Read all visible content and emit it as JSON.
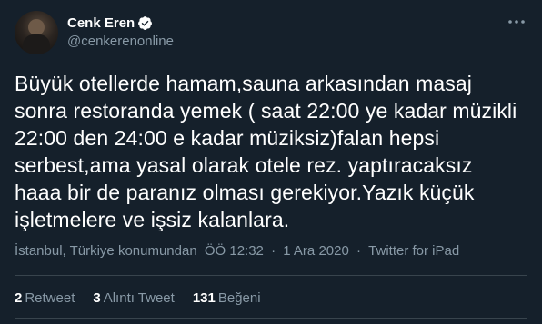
{
  "author": {
    "display_name": "Cenk Eren",
    "handle": "@cenkerenonline",
    "verified": true,
    "avatar_icon": "profile-photo"
  },
  "more_icon": "more-options-icon",
  "tweet": {
    "text": "Büyük otellerde hamam,sauna arkasından masaj sonra restoranda yemek ( saat 22:00 ye kadar müzikli 22:00 den 24:00 e kadar müziksiz)falan hepsi serbest,ama yasal olarak otele rez. yaptıracaksız haaa bir de paranız olması gerekiyor.Yazık küçük işletmelere ve işsiz kalanlara.",
    "location": "İstanbul, Türkiye konumundan",
    "time": "ÖÖ 12:32",
    "date": "1 Ara 2020",
    "source": "Twitter for iPad",
    "separator": "·"
  },
  "stats": {
    "retweets_count": "2",
    "retweets_label": "Retweet",
    "quotes_count": "3",
    "quotes_label": "Alıntı Tweet",
    "likes_count": "131",
    "likes_label": "Beğeni"
  },
  "colors": {
    "background": "#15202b",
    "text_primary": "#ffffff",
    "text_secondary": "#8899a6",
    "divider": "#38444d",
    "verified_badge": "#ffffff"
  }
}
